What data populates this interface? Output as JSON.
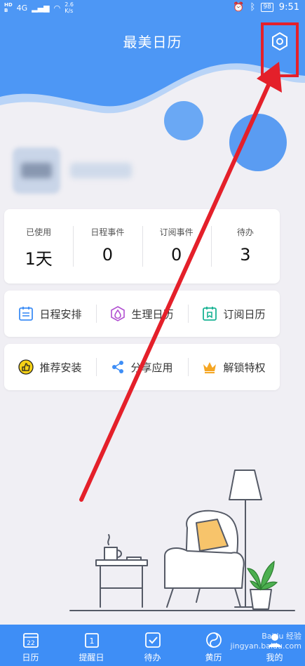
{
  "status_bar": {
    "sim_tags": [
      "HD",
      "B"
    ],
    "network": "4G",
    "speed": "2.6",
    "speed_unit": "K/s",
    "battery": "98",
    "time": "9:51"
  },
  "header": {
    "title": "最美日历"
  },
  "stats": [
    {
      "label": "已使用",
      "value": "1天"
    },
    {
      "label": "日程事件",
      "value": "0"
    },
    {
      "label": "订阅事件",
      "value": "0"
    },
    {
      "label": "待办",
      "value": "3"
    }
  ],
  "features_row1": [
    {
      "label": "日程安排",
      "icon": "schedule-icon"
    },
    {
      "label": "生理日历",
      "icon": "drop-icon"
    },
    {
      "label": "订阅日历",
      "icon": "subscribe-icon"
    }
  ],
  "features_row2": [
    {
      "label": "推荐安装",
      "icon": "thumb-icon"
    },
    {
      "label": "分享应用",
      "icon": "share-icon"
    },
    {
      "label": "解锁特权",
      "icon": "crown-icon"
    }
  ],
  "nav": [
    {
      "label": "日历",
      "icon": "calendar-icon",
      "badge": "22"
    },
    {
      "label": "提醒日",
      "icon": "reminder-icon",
      "badge": "1"
    },
    {
      "label": "待办",
      "icon": "todo-icon"
    },
    {
      "label": "黄历",
      "icon": "almanac-icon"
    },
    {
      "label": "我的",
      "icon": "profile-icon"
    }
  ],
  "watermark": "Baidu 经验 jingyan.baidu.com",
  "colors": {
    "primary": "#3e8ef6",
    "highlight": "#e4202a",
    "background": "#f0eff4"
  }
}
